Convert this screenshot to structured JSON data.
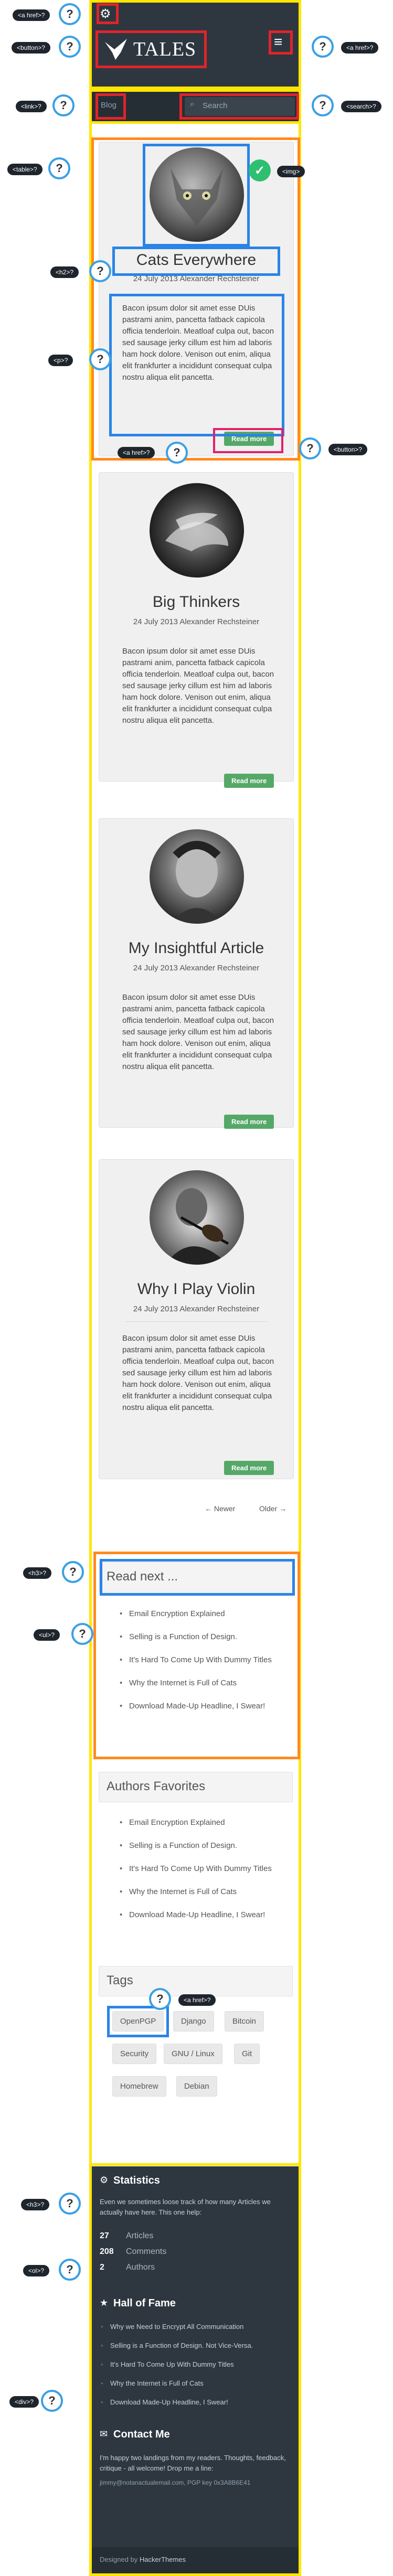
{
  "annotations": {
    "a_href_top": "<a href>?",
    "button": "<button>?",
    "a_href_right": "<a href>?",
    "link": "<link>?",
    "search": "<search>?",
    "table": "<table>?",
    "img": "<img>",
    "h2": "<h2>?",
    "p": "<p>?",
    "a_href_read": "<a href>?",
    "button_read": "<button>?",
    "h3_read": "<h3>?",
    "ul": "<ul>?",
    "a_href_tags": "<a href>?",
    "h3_stats": "<h3>?",
    "ol": "<ol>?",
    "div": "<div>?",
    "q": "?"
  },
  "header": {
    "brand": "TALES",
    "menu_icon": "≡"
  },
  "nav": {
    "blog": "Blog",
    "search_placeholder": "Search"
  },
  "posts": [
    {
      "title": "Cats Everywhere",
      "meta": "24 July 2013 Alexander Rechsteiner",
      "body": "Bacon ipsum dolor sit amet esse DUis pastrami anim, pancetta fatback capicola officia tenderloin. Meatloaf culpa out, bacon sed sausage jerky cillum est him ad laboris ham hock dolore. Venison out enim, aliqua elit frankfurter a incididunt consequat culpa nostru aliqua elit pancetta.",
      "read_more": "Read more"
    },
    {
      "title": "Big Thinkers",
      "meta": "24 July 2013 Alexander Rechsteiner",
      "body": "Bacon ipsum dolor sit amet esse DUis pastrami anim, pancetta fatback capicola officia tenderloin. Meatloaf culpa out, bacon sed sausage jerky cillum est him ad laboris ham hock dolore. Venison out enim, aliqua elit frankfurter a incididunt consequat culpa nostru aliqua elit pancetta.",
      "read_more": "Read more"
    },
    {
      "title": "My Insightful Article",
      "meta": "24 July 2013 Alexander Rechsteiner",
      "body": "Bacon ipsum dolor sit amet esse DUis pastrami anim, pancetta fatback capicola officia tenderloin. Meatloaf culpa out, bacon sed sausage jerky cillum est him ad laboris ham hock dolore. Venison out enim, aliqua elit frankfurter a incididunt consequat culpa nostru aliqua elit pancetta.",
      "read_more": "Read more"
    },
    {
      "title": "Why I Play Violin",
      "meta": "24 July 2013 Alexander Rechsteiner",
      "body": "Bacon ipsum dolor sit amet esse DUis pastrami anim, pancetta fatback capicola officia tenderloin. Meatloaf culpa out, bacon sed sausage jerky cillum est him ad laboris ham hock dolore. Venison out enim, aliqua elit frankfurter a incididunt consequat culpa nostru aliqua elit pancetta.",
      "read_more": "Read more"
    }
  ],
  "pagination": {
    "newer": "← Newer",
    "older": "Older →"
  },
  "read_next": {
    "title": "Read next ...",
    "items": [
      "Email Encryption Explained",
      "Selling is a Function of Design.",
      "It's Hard To Come Up With Dummy Titles",
      "Why the Internet is Full of Cats",
      "Download Made-Up Headline, I Swear!"
    ]
  },
  "authors": {
    "title": "Authors Favorites",
    "items": [
      "Email Encryption Explained",
      "Selling is a Function of Design.",
      "It's Hard To Come Up With Dummy Titles",
      "Why the Internet is Full of Cats",
      "Download Made-Up Headline, I Swear!"
    ]
  },
  "tags": {
    "title": "Tags",
    "items": [
      "OpenPGP",
      "Django",
      "Bitcoin",
      "Security",
      "GNU / Linux",
      "Git",
      "Homebrew",
      "Debian"
    ]
  },
  "stats": {
    "title": "Statistics",
    "intro": "Even we sometimes loose track of how many Articles we actually have here. This one help:",
    "rows": [
      {
        "num": "27",
        "label": "Articles"
      },
      {
        "num": "208",
        "label": "Comments"
      },
      {
        "num": "2",
        "label": "Authors"
      }
    ]
  },
  "hall": {
    "title": "Hall of Fame",
    "items": [
      "Why we Need to Encrypt All Communication",
      "Selling is a Function of Design. Not Vice-Versa.",
      "It's Hard To Come Up With Dummy Titles",
      "Why the Internet is Full of Cats",
      "Download Made-Up Headline, I Swear!"
    ]
  },
  "contact": {
    "title": "Contact Me",
    "text": "I'm happy two landings from my readers. Thoughts, feedback, critique - all welcome! Drop me a line:",
    "email": "jimmy@notanactualemail.com, PGP key 0x3A8B6E41"
  },
  "footer": {
    "prefix": "Designed by ",
    "link": "HackerThemes"
  },
  "colors": {
    "annotation_yellow": "#ffe600",
    "annotation_orange": "#ff8a1f",
    "annotation_blue": "#2a84e6",
    "annotation_red": "#e0242a",
    "dark_bg": "#2e3740",
    "read_more_green": "#55a868"
  }
}
